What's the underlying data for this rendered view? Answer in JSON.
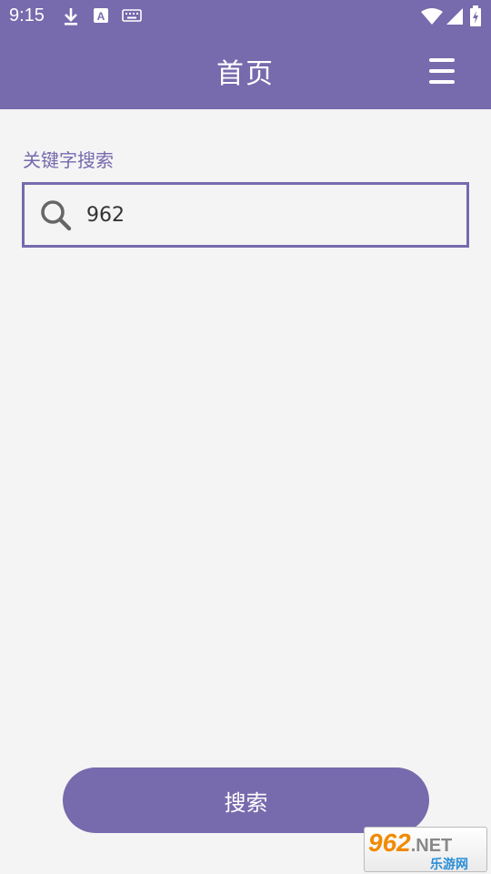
{
  "status_bar": {
    "time": "9:15",
    "icons": [
      "download-icon",
      "a-notification-icon",
      "keyboard-icon",
      "wifi-icon",
      "signal-icon",
      "battery-icon"
    ]
  },
  "app_bar": {
    "title": "首页",
    "menu_icon": "menu-icon"
  },
  "search": {
    "label": "关键字搜索",
    "value": "962",
    "icon": "search-icon"
  },
  "actions": {
    "search_button_label": "搜索"
  },
  "watermark": {
    "logo_text": "962",
    "logo_suffix": ".NET",
    "sub_text": "乐游网"
  },
  "colors": {
    "primary": "#776aad",
    "background": "#f4f4f4",
    "text_on_primary": "#ffffff"
  }
}
